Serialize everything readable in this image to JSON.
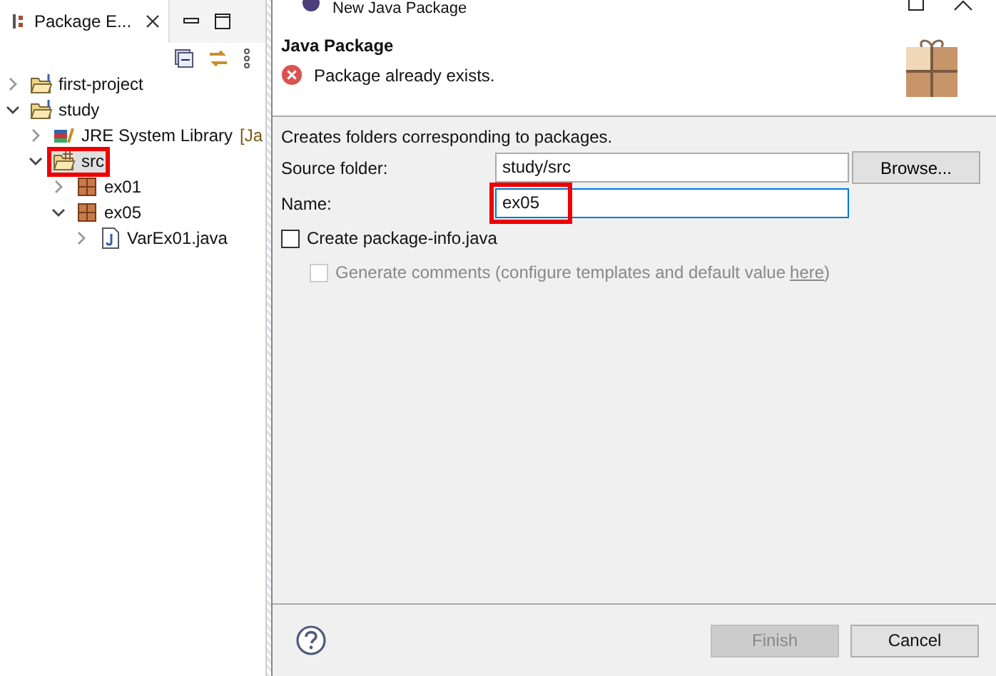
{
  "explorer": {
    "title": "Package E...",
    "tree": [
      {
        "label": "first-project",
        "kind": "project",
        "expanded": false,
        "selected": false,
        "marked": false
      },
      {
        "label": "study",
        "kind": "project",
        "expanded": true,
        "selected": false,
        "marked": false,
        "children": [
          {
            "label": "JRE System Library",
            "suffix": "[Ja",
            "kind": "library",
            "expanded": false,
            "selected": false,
            "marked": false
          },
          {
            "label": "src",
            "kind": "source",
            "expanded": true,
            "selected": true,
            "marked": true,
            "children": [
              {
                "label": "ex01",
                "kind": "package",
                "expanded": false,
                "selected": false,
                "marked": false
              },
              {
                "label": "ex05",
                "kind": "package",
                "expanded": true,
                "selected": false,
                "marked": false,
                "children": [
                  {
                    "label": "VarEx01.java",
                    "kind": "file",
                    "expanded": false,
                    "selected": false,
                    "marked": false
                  }
                ]
              }
            ]
          }
        ]
      }
    ]
  },
  "dialog": {
    "title": "New Java Package",
    "heading": "Java Package",
    "message": "Package already exists.",
    "description": "Creates folders corresponding to packages.",
    "source_folder": {
      "label": "Source folder:",
      "value": "study/src",
      "button": "Browse..."
    },
    "name": {
      "label": "Name:",
      "value": "ex05",
      "marked": true
    },
    "create_info": {
      "label": "Create package-info.java",
      "checked": false,
      "disabled": false
    },
    "generate_comments": {
      "label": "Generate comments (configure templates and default value ",
      "link": "here",
      "suffix": ")",
      "checked": false,
      "disabled": true
    },
    "buttons": [
      {
        "label": "Finish",
        "disabled": true
      },
      {
        "label": "Cancel",
        "disabled": false
      }
    ]
  }
}
